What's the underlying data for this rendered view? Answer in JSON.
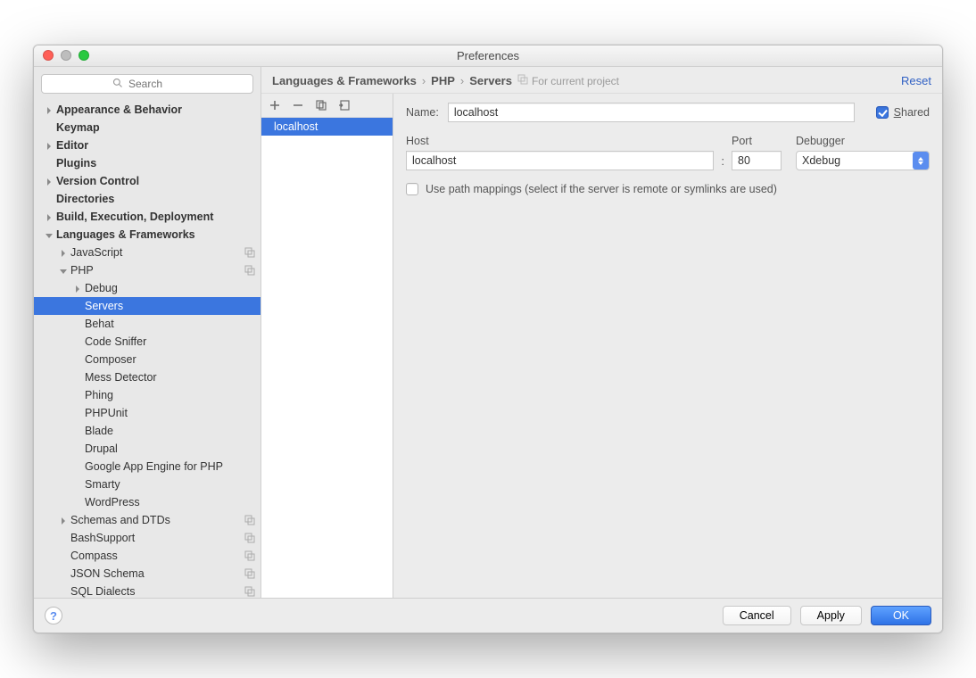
{
  "window": {
    "title": "Preferences"
  },
  "search": {
    "placeholder": "Search"
  },
  "sidebar": {
    "items": [
      {
        "label": "Appearance & Behavior",
        "indent": 0,
        "arrow": "right",
        "bold": true
      },
      {
        "label": "Keymap",
        "indent": 0,
        "arrow": "none",
        "bold": true
      },
      {
        "label": "Editor",
        "indent": 0,
        "arrow": "right",
        "bold": true
      },
      {
        "label": "Plugins",
        "indent": 0,
        "arrow": "none",
        "bold": true
      },
      {
        "label": "Version Control",
        "indent": 0,
        "arrow": "right",
        "bold": true
      },
      {
        "label": "Directories",
        "indent": 0,
        "arrow": "none",
        "bold": true
      },
      {
        "label": "Build, Execution, Deployment",
        "indent": 0,
        "arrow": "right",
        "bold": true
      },
      {
        "label": "Languages & Frameworks",
        "indent": 0,
        "arrow": "down",
        "bold": true
      },
      {
        "label": "JavaScript",
        "indent": 1,
        "arrow": "right",
        "badge": true
      },
      {
        "label": "PHP",
        "indent": 1,
        "arrow": "down",
        "badge": true
      },
      {
        "label": "Debug",
        "indent": 2,
        "arrow": "right"
      },
      {
        "label": "Servers",
        "indent": 2,
        "arrow": "none",
        "selected": true
      },
      {
        "label": "Behat",
        "indent": 2,
        "arrow": "none"
      },
      {
        "label": "Code Sniffer",
        "indent": 2,
        "arrow": "none"
      },
      {
        "label": "Composer",
        "indent": 2,
        "arrow": "none"
      },
      {
        "label": "Mess Detector",
        "indent": 2,
        "arrow": "none"
      },
      {
        "label": "Phing",
        "indent": 2,
        "arrow": "none"
      },
      {
        "label": "PHPUnit",
        "indent": 2,
        "arrow": "none"
      },
      {
        "label": "Blade",
        "indent": 2,
        "arrow": "none"
      },
      {
        "label": "Drupal",
        "indent": 2,
        "arrow": "none"
      },
      {
        "label": "Google App Engine for PHP",
        "indent": 2,
        "arrow": "none"
      },
      {
        "label": "Smarty",
        "indent": 2,
        "arrow": "none"
      },
      {
        "label": "WordPress",
        "indent": 2,
        "arrow": "none"
      },
      {
        "label": "Schemas and DTDs",
        "indent": 1,
        "arrow": "right",
        "badge": true
      },
      {
        "label": "BashSupport",
        "indent": 1,
        "arrow": "none",
        "badge": true
      },
      {
        "label": "Compass",
        "indent": 1,
        "arrow": "none",
        "badge": true
      },
      {
        "label": "JSON Schema",
        "indent": 1,
        "arrow": "none",
        "badge": true
      },
      {
        "label": "SQL Dialects",
        "indent": 1,
        "arrow": "none",
        "badge": true
      }
    ]
  },
  "breadcrumb": {
    "parts": [
      "Languages & Frameworks",
      "PHP",
      "Servers"
    ],
    "for_project": "For current project",
    "reset": "Reset"
  },
  "servers": {
    "items": [
      "localhost"
    ]
  },
  "form": {
    "name_label": "Name:",
    "name_value": "localhost",
    "shared_label": "Shared",
    "shared_checked": true,
    "host_label": "Host",
    "host_value": "localhost",
    "port_label": "Port",
    "port_value": "80",
    "debugger_label": "Debugger",
    "debugger_value": "Xdebug",
    "path_mappings_label": "Use path mappings (select if the server is remote or symlinks are used)",
    "path_mappings_checked": false
  },
  "footer": {
    "cancel": "Cancel",
    "apply": "Apply",
    "ok": "OK"
  }
}
